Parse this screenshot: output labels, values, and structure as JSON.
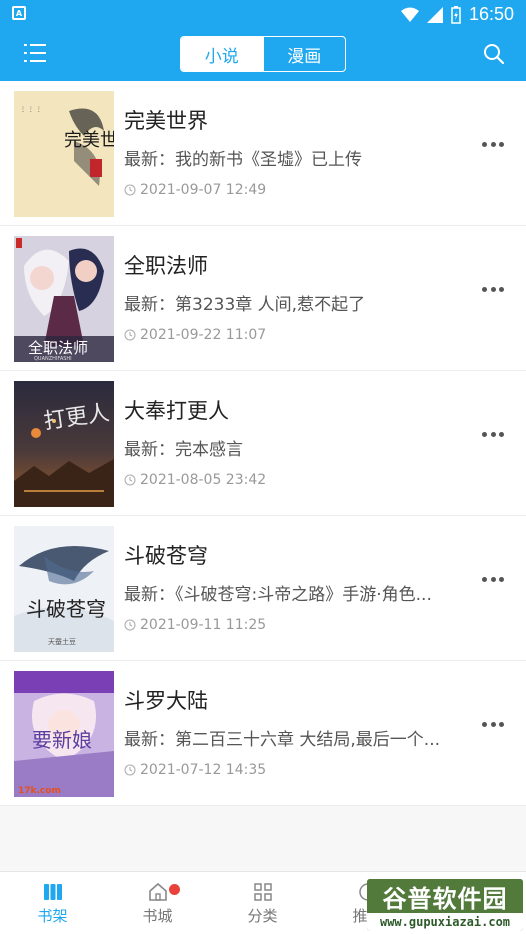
{
  "status_bar": {
    "time": "16:50"
  },
  "app_bar": {
    "tabs": [
      {
        "label": "小说"
      },
      {
        "label": "漫画"
      }
    ]
  },
  "books": [
    {
      "title": "完美世界",
      "latest": "最新：我的新书《圣墟》已上传",
      "date": "2021-09-07 12:49"
    },
    {
      "title": "全职法师",
      "latest": "最新：第3233章 人间,惹不起了",
      "date": "2021-09-22 11:07"
    },
    {
      "title": "大奉打更人",
      "latest": "最新：完本感言",
      "date": "2021-08-05 23:42"
    },
    {
      "title": "斗破苍穹",
      "latest": "最新：《斗破苍穹:斗帝之路》手游·角色...",
      "date": "2021-09-11 11:25"
    },
    {
      "title": "斗罗大陆",
      "latest": "最新：第二百三十六章 大结局,最后一个...",
      "date": "2021-07-12 14:35"
    }
  ],
  "bottom_nav": [
    {
      "label": "书架",
      "active": true
    },
    {
      "label": "书城",
      "badge": true
    },
    {
      "label": "分类"
    },
    {
      "label": "推荐"
    }
  ],
  "watermark": {
    "brand": "谷普软件园",
    "url": "www.gupuxiazai.com"
  },
  "colors": {
    "primary": "#1fa8f0",
    "badge": "#e8423a"
  },
  "covers": {
    "book1": {
      "text": "完美世界"
    },
    "book2": {
      "text": "全职法师",
      "subtext": "QUANZHIFASHI"
    },
    "book3": {
      "text": "打更人"
    },
    "book4": {
      "text": "斗破苍穹",
      "subtext": "天蚕土豆"
    },
    "book5": {
      "text": "要新娘",
      "subtext": "17k.com"
    }
  }
}
